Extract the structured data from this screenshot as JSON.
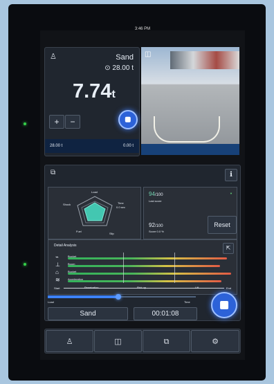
{
  "status": {
    "time": "3:46 PM"
  },
  "top_panel": {
    "material": "Sand",
    "target": "28.00 t",
    "current_value": "7.74",
    "current_unit": "t",
    "bottom_left": "28.00 t",
    "bottom_right": "0.00 t"
  },
  "analysis": {
    "radar_labels": [
      "Load",
      "Time",
      "Slip",
      "Fuel",
      "Shock"
    ],
    "time_detail": "0.0 sec",
    "score_top": "94",
    "score_top_suffix": "/100",
    "score_top_label": "Last score",
    "score_bottom": "92",
    "score_bottom_suffix": "/100",
    "score_bottom_label": "Score 0.0 %",
    "reset": "Reset",
    "detail_title": "Detail Analysis",
    "rows": [
      "Bucket",
      "Boom",
      "Bucket",
      "Acceleration"
    ],
    "axis_start": "Start",
    "axis_end": "End",
    "markers": [
      "Penetration",
      "Pick up",
      "Lift"
    ],
    "load_label": "Load",
    "time_label": "Time",
    "mode": "Sand",
    "elapsed": "00:01:08"
  },
  "icons": {
    "home": "worker-icon",
    "camera": "camera-icon",
    "report": "report-icon",
    "settings": "settings-icon"
  }
}
